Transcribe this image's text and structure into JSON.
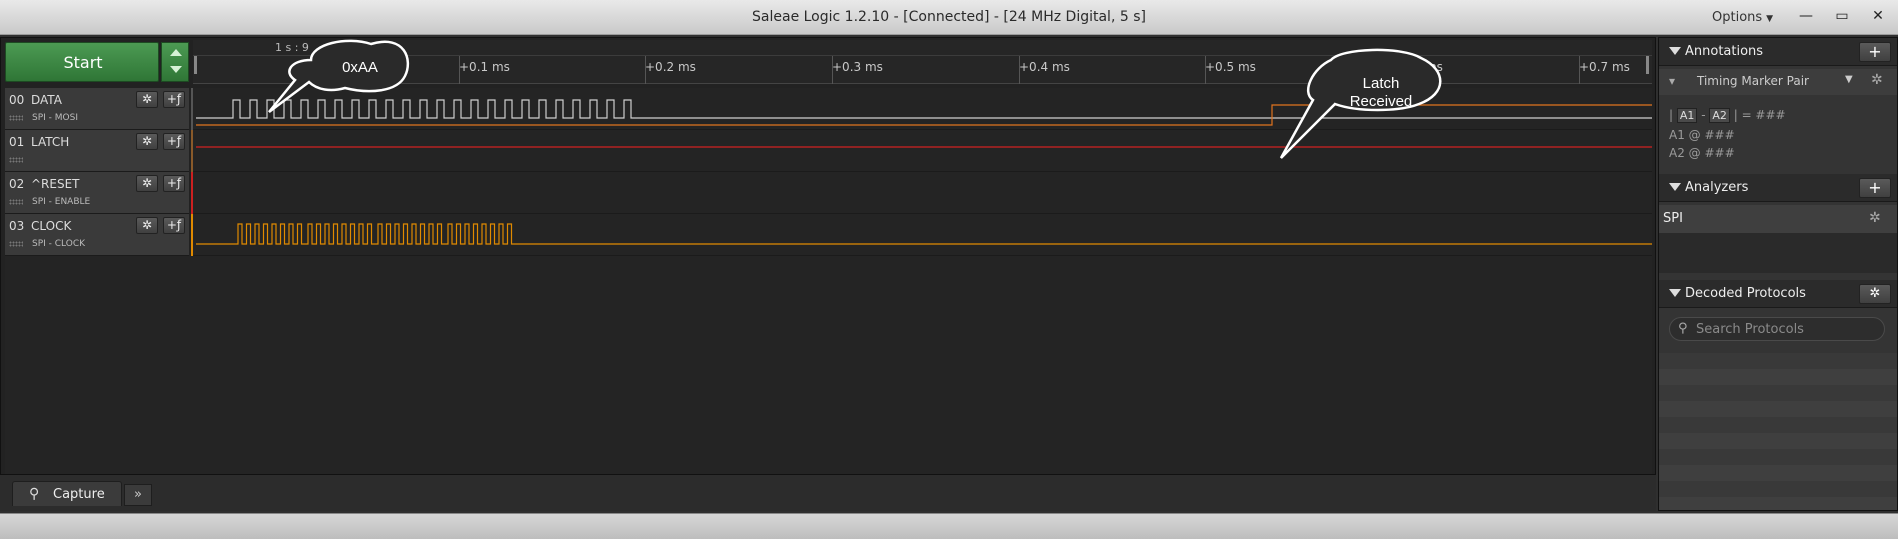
{
  "window": {
    "title": "Saleae Logic 1.2.10 - [Connected] - [24 MHz Digital, 5 s]",
    "options_label": "Options",
    "min_icon": "minimize-icon",
    "max_icon": "maximize-icon",
    "close_icon": "close-icon"
  },
  "toolbar": {
    "start_label": "Start"
  },
  "ruler": {
    "top_label": "1 s : 9",
    "ticks": [
      "+0.1 ms",
      "+0.2 ms",
      "+0.3 ms",
      "+0.4 ms",
      "+0.5 ms",
      "+0.6 ms",
      "+0.7 ms"
    ]
  },
  "channels": [
    {
      "num": "00",
      "name": "DATA",
      "sub": "SPI - MOSI",
      "color": "#555555"
    },
    {
      "num": "01",
      "name": "LATCH",
      "sub": "",
      "color": "#8a5a2a"
    },
    {
      "num": "02",
      "name": "^RESET",
      "sub": "SPI - ENABLE",
      "color": "#cc2020"
    },
    {
      "num": "03",
      "name": "CLOCK",
      "sub": "SPI - CLOCK",
      "color": "#e08a00"
    }
  ],
  "callouts": {
    "data_value": "0xAA",
    "latch_line1": "Latch",
    "latch_line2": "Received"
  },
  "bottom": {
    "capture_tab": "Capture",
    "more_tab": "»"
  },
  "annotations": {
    "header": "Annotations",
    "marker_pair": "Timing Marker Pair",
    "delta_a1": "A1",
    "delta_a2": "A2",
    "delta_value": "= ###",
    "a1_line": "A1  @  ###",
    "a2_line": "A2  @  ###"
  },
  "analyzers": {
    "header": "Analyzers",
    "items": [
      "SPI"
    ]
  },
  "decoded": {
    "header": "Decoded Protocols",
    "search_placeholder": "Search Protocols"
  }
}
